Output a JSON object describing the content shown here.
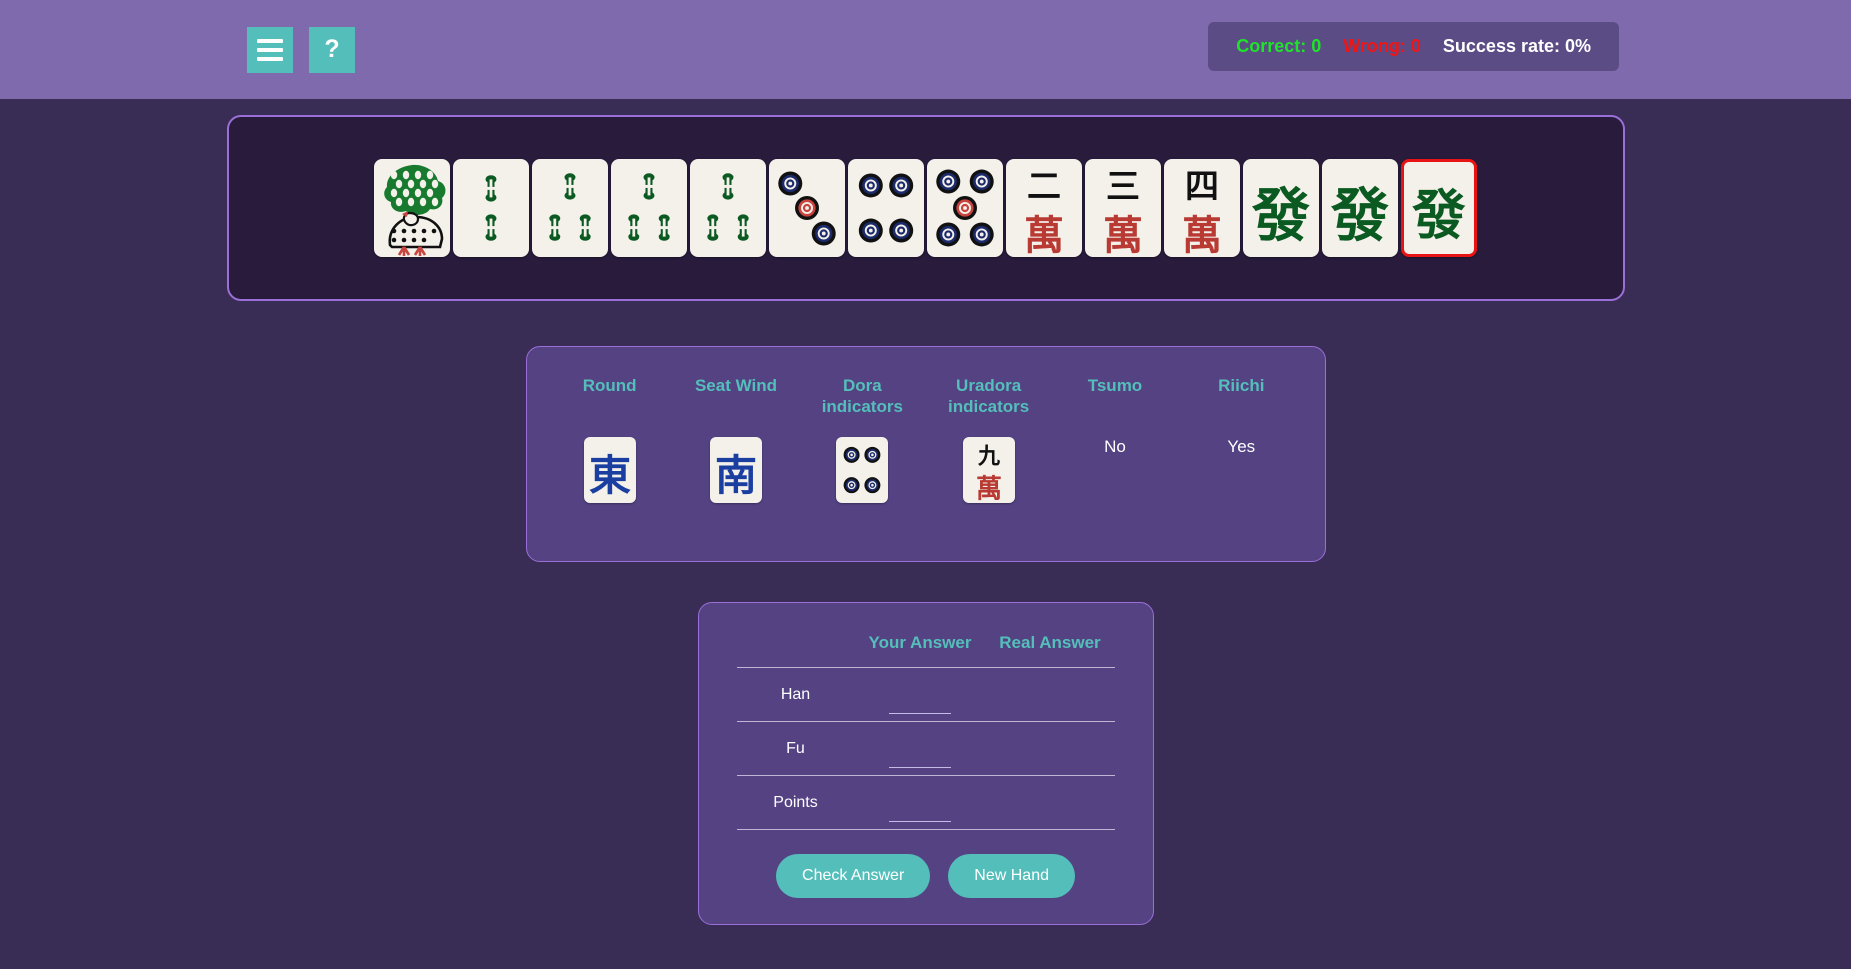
{
  "header": {
    "menu_icon": "hamburger-icon",
    "help_label": "?",
    "score": {
      "correct_label": "Correct: 0",
      "wrong_label": "Wrong: 0",
      "rate_label": "Success rate: 0%",
      "correct_color": "#1fe32a",
      "wrong_color": "#f01414",
      "rate_color": "#ffffff"
    }
  },
  "hand": {
    "tiles": [
      {
        "name": "1-bamboo",
        "suit": "bamboo",
        "value": 1,
        "winning": false
      },
      {
        "name": "2-bamboo",
        "suit": "bamboo",
        "value": 2,
        "winning": false
      },
      {
        "name": "3-bamboo",
        "suit": "bamboo",
        "value": 3,
        "winning": false
      },
      {
        "name": "3-bamboo",
        "suit": "bamboo",
        "value": 3,
        "winning": false
      },
      {
        "name": "3-bamboo",
        "suit": "bamboo",
        "value": 3,
        "winning": false
      },
      {
        "name": "3-dots",
        "suit": "dots",
        "value": 3,
        "winning": false
      },
      {
        "name": "4-dots",
        "suit": "dots",
        "value": 4,
        "winning": false
      },
      {
        "name": "5-dots",
        "suit": "dots",
        "value": 5,
        "winning": false
      },
      {
        "name": "2-characters",
        "suit": "characters",
        "value": 2,
        "glyph": "二",
        "winning": false
      },
      {
        "name": "3-characters",
        "suit": "characters",
        "value": 3,
        "glyph": "三",
        "winning": false
      },
      {
        "name": "4-characters",
        "suit": "characters",
        "value": 4,
        "glyph": "四",
        "winning": false
      },
      {
        "name": "green-dragon",
        "suit": "honor",
        "glyph": "發",
        "winning": false
      },
      {
        "name": "green-dragon",
        "suit": "honor",
        "glyph": "發",
        "winning": false
      },
      {
        "name": "green-dragon",
        "suit": "honor",
        "glyph": "發",
        "winning": true
      }
    ]
  },
  "info": {
    "round": {
      "label": "Round",
      "tile_glyph": "東",
      "tile_name": "east-wind"
    },
    "seat_wind": {
      "label": "Seat Wind",
      "tile_glyph": "南",
      "tile_name": "south-wind"
    },
    "dora": {
      "label": "Dora indicators",
      "tile_name": "4-dots"
    },
    "uradora": {
      "label": "Uradora indicators",
      "tile_glyph": "九",
      "tile_name": "9-characters"
    },
    "tsumo": {
      "label": "Tsumo",
      "value": "No"
    },
    "riichi": {
      "label": "Riichi",
      "value": "Yes"
    }
  },
  "answer": {
    "col_your": "Your Answer",
    "col_real": "Real Answer",
    "rows": [
      {
        "label": "Han",
        "your_value": "",
        "real_value": ""
      },
      {
        "label": "Fu",
        "your_value": "",
        "real_value": ""
      },
      {
        "label": "Points",
        "your_value": "",
        "real_value": ""
      }
    ],
    "check_label": "Check Answer",
    "new_hand_label": "New Hand"
  },
  "colors": {
    "page_bg": "#3a2d55",
    "topbar_bg": "#7e6aad",
    "panel_bg": "#544283",
    "hand_bg": "#281b3c",
    "accent": "#54bfba",
    "border": "#9a6fd8",
    "win_border": "#e81313"
  }
}
